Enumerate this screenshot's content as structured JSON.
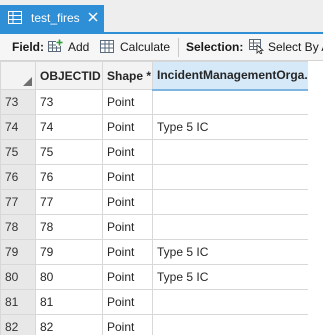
{
  "tab": {
    "title": "test_fires"
  },
  "toolbar": {
    "field_label": "Field:",
    "add_label": "Add",
    "calculate_label": "Calculate",
    "selection_label": "Selection:",
    "select_by_label": "Select By A"
  },
  "columns": {
    "objectid": "OBJECTID *",
    "shape": "Shape *",
    "incident": "IncidentManagementOrga..."
  },
  "rows": [
    {
      "num": "73",
      "objectid": "73",
      "shape": "Point",
      "incident": ""
    },
    {
      "num": "74",
      "objectid": "74",
      "shape": "Point",
      "incident": "Type 5 IC"
    },
    {
      "num": "75",
      "objectid": "75",
      "shape": "Point",
      "incident": ""
    },
    {
      "num": "76",
      "objectid": "76",
      "shape": "Point",
      "incident": ""
    },
    {
      "num": "77",
      "objectid": "77",
      "shape": "Point",
      "incident": ""
    },
    {
      "num": "78",
      "objectid": "78",
      "shape": "Point",
      "incident": ""
    },
    {
      "num": "79",
      "objectid": "79",
      "shape": "Point",
      "incident": "Type 5 IC"
    },
    {
      "num": "80",
      "objectid": "80",
      "shape": "Point",
      "incident": "Type 5 IC"
    },
    {
      "num": "81",
      "objectid": "81",
      "shape": "Point",
      "incident": ""
    },
    {
      "num": "82",
      "objectid": "82",
      "shape": "Point",
      "incident": ""
    }
  ],
  "colors": {
    "accent": "#2f8fd6",
    "selected_header": "#d6e9f8"
  },
  "icons": [
    "table-icon",
    "close-icon",
    "add-field-icon",
    "calculate-icon",
    "select-by-icon"
  ]
}
